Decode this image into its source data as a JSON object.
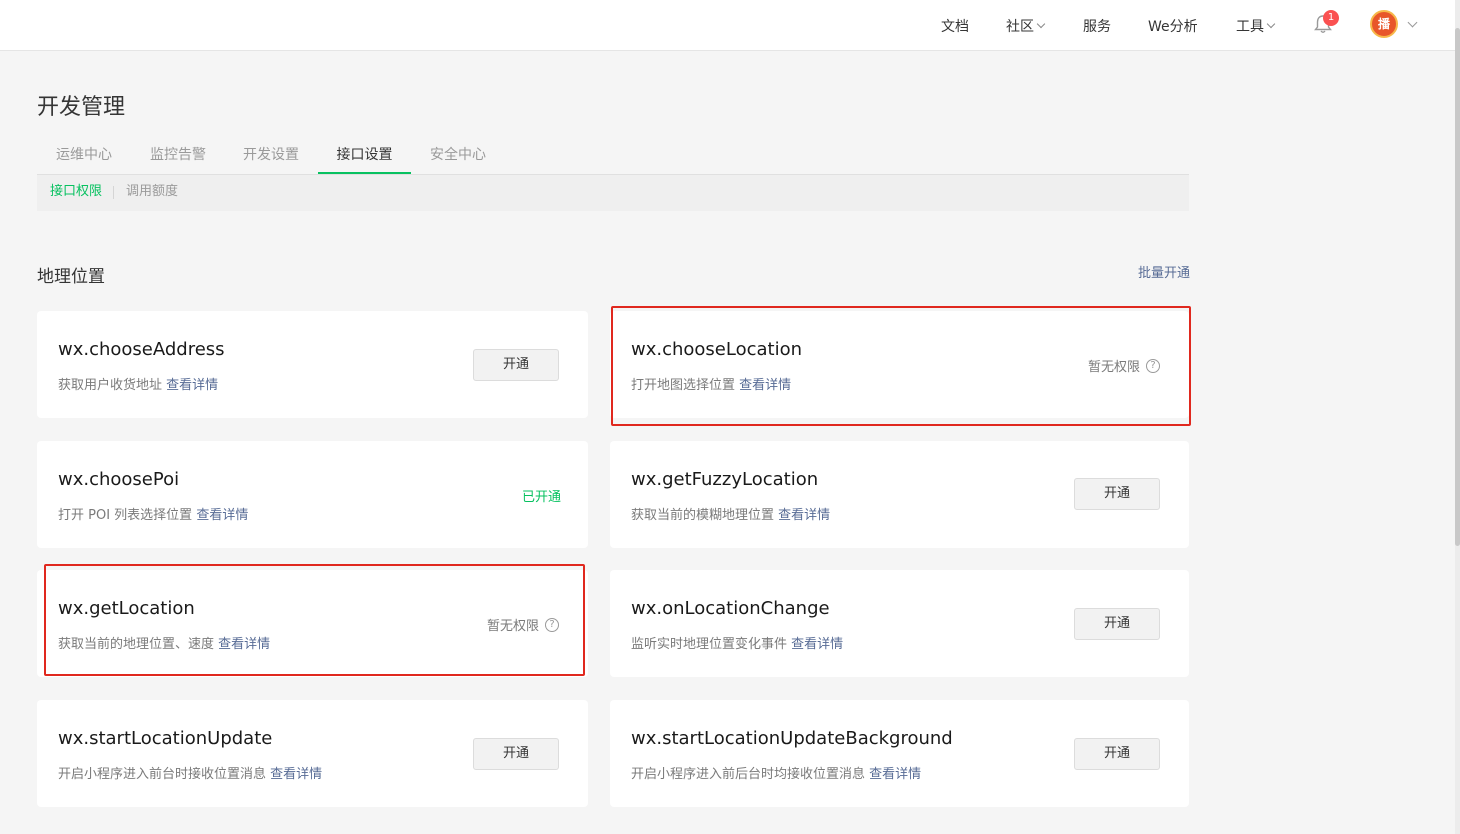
{
  "nav": {
    "items": [
      {
        "label": "文档",
        "dropdown": false
      },
      {
        "label": "社区",
        "dropdown": true
      },
      {
        "label": "服务",
        "dropdown": false
      },
      {
        "label": "We分析",
        "dropdown": false
      },
      {
        "label": "工具",
        "dropdown": true
      }
    ],
    "notification_count": "1",
    "avatar_text": "播"
  },
  "page": {
    "title": "开发管理",
    "tabs": [
      "运维中心",
      "监控告警",
      "开发设置",
      "接口设置",
      "安全中心"
    ],
    "active_tab": "接口设置",
    "subtabs": [
      "接口权限",
      "调用额度"
    ],
    "active_subtab": "接口权限"
  },
  "section": {
    "title": "地理位置",
    "batch_label": "批量开通"
  },
  "labels": {
    "open_button": "开通",
    "no_permission": "暂无权限",
    "opened": "已开通",
    "details_link": "查看详情"
  },
  "apis": [
    {
      "name": "wx.chooseAddress",
      "desc": "获取用户收货地址",
      "status": "open_button",
      "highlighted": false
    },
    {
      "name": "wx.chooseLocation",
      "desc": "打开地图选择位置",
      "status": "no_permission",
      "highlighted": true
    },
    {
      "name": "wx.choosePoi",
      "desc": "打开 POI 列表选择位置",
      "status": "opened",
      "highlighted": false
    },
    {
      "name": "wx.getFuzzyLocation",
      "desc": "获取当前的模糊地理位置",
      "status": "open_button",
      "highlighted": false
    },
    {
      "name": "wx.getLocation",
      "desc": "获取当前的地理位置、速度",
      "status": "no_permission",
      "highlighted": true
    },
    {
      "name": "wx.onLocationChange",
      "desc": "监听实时地理位置变化事件",
      "status": "open_button",
      "highlighted": false
    },
    {
      "name": "wx.startLocationUpdate",
      "desc": "开启小程序进入前台时接收位置消息",
      "status": "open_button",
      "highlighted": false
    },
    {
      "name": "wx.startLocationUpdateBackground",
      "desc": "开启小程序进入前后台时均接收位置消息",
      "status": "open_button",
      "highlighted": false
    }
  ],
  "colors": {
    "accent": "#07c160",
    "link": "#576b95",
    "highlight": "#e0281e",
    "badge": "#fa5151"
  }
}
